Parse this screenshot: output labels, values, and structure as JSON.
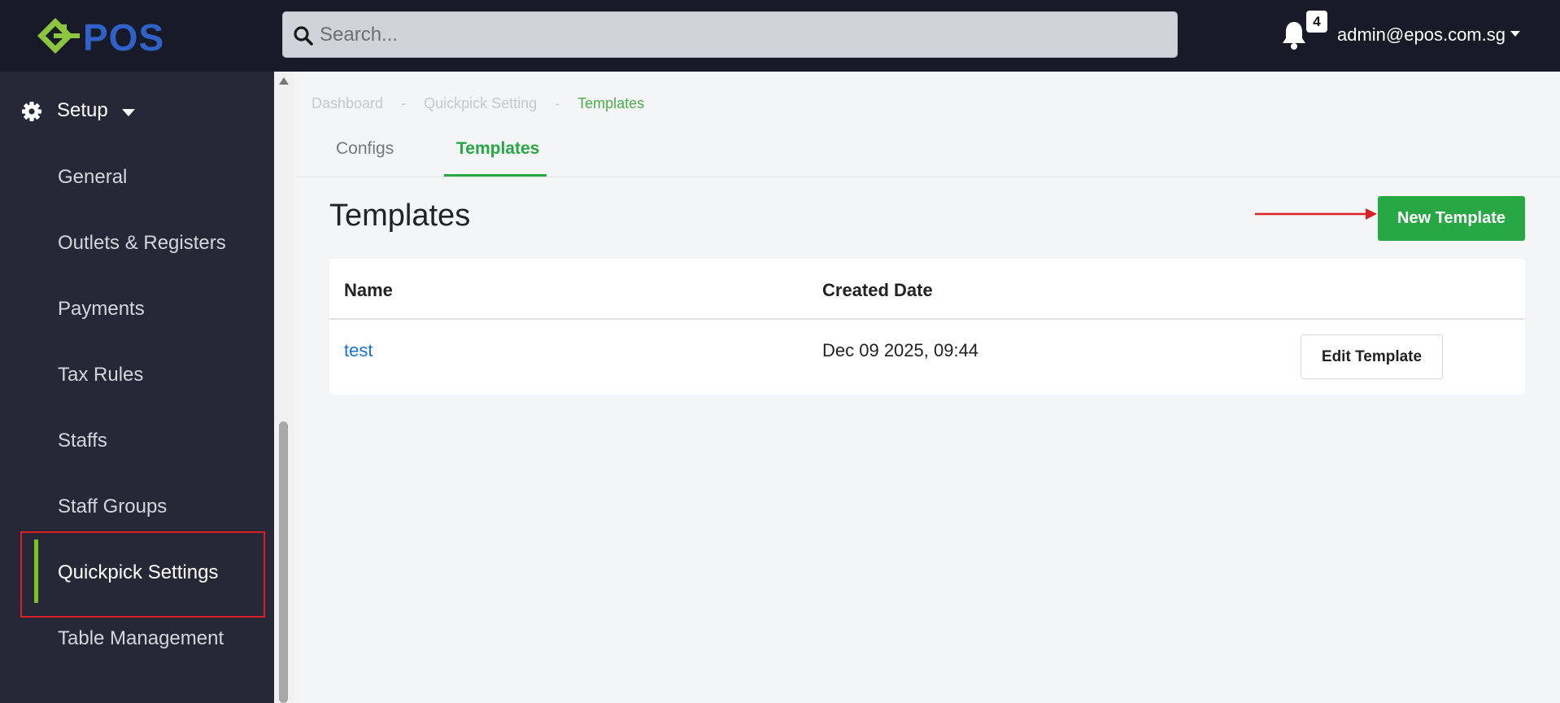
{
  "app": {
    "logo_text": "EPOS"
  },
  "topbar": {
    "search_placeholder": "Search...",
    "notification_count": "4",
    "user_email": "admin@epos.com.sg"
  },
  "sidebar": {
    "section_label": "Setup",
    "items": [
      {
        "label": "General"
      },
      {
        "label": "Outlets & Registers"
      },
      {
        "label": "Payments"
      },
      {
        "label": "Tax Rules"
      },
      {
        "label": "Staffs"
      },
      {
        "label": "Staff Groups"
      },
      {
        "label": "Quickpick Settings",
        "active": true
      },
      {
        "label": "Table Management"
      }
    ]
  },
  "breadcrumb": {
    "items": [
      "Dashboard",
      "Quickpick Setting",
      "Templates"
    ],
    "separator": "-"
  },
  "tabs": [
    {
      "label": "Configs",
      "active": false
    },
    {
      "label": "Templates",
      "active": true
    }
  ],
  "main": {
    "title": "Templates",
    "new_button_label": "New Template"
  },
  "table": {
    "columns": [
      "Name",
      "Created Date"
    ],
    "rows": [
      {
        "name": "test",
        "created_date": "Dec 09 2025, 09:44",
        "action_label": "Edit Template"
      }
    ]
  },
  "colors": {
    "topbar_bg": "#191a28",
    "sidebar_bg": "#262838",
    "accent_green": "#28a745",
    "active_indicator": "#7bc41e",
    "annotation_red": "#d92027",
    "link_blue": "#1a73d9"
  }
}
